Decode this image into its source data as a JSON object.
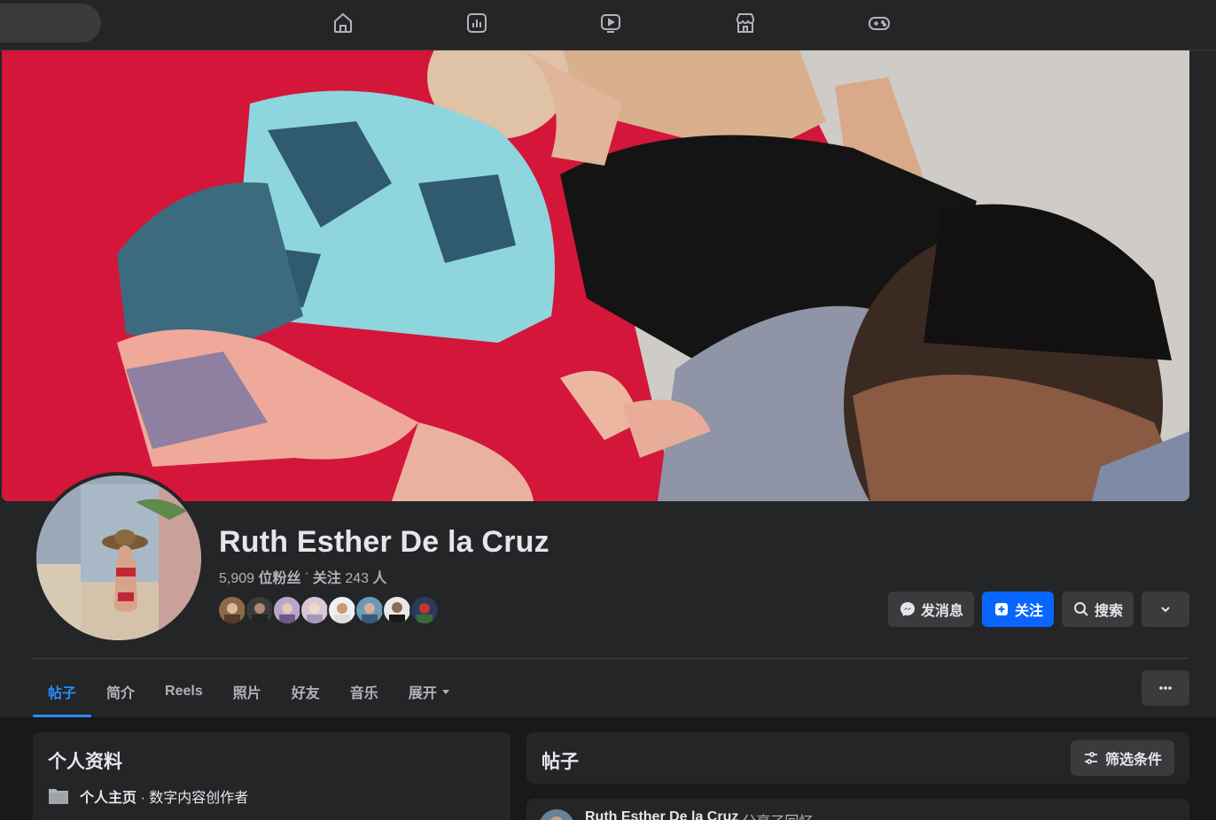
{
  "nav": {
    "icons": [
      "home-icon",
      "dashboard-icon",
      "video-icon",
      "marketplace-icon",
      "gaming-icon"
    ]
  },
  "profile": {
    "name": "Ruth Esther De la Cruz",
    "followers_count": "5,909",
    "followers_label": "位粉丝",
    "separator": "·",
    "following_label": "关注",
    "following_count": "243",
    "following_unit": "人"
  },
  "actions": {
    "message": "发消息",
    "follow": "关注",
    "search": "搜索"
  },
  "tabs": [
    {
      "label": "帖子",
      "active": true
    },
    {
      "label": "简介"
    },
    {
      "label": "Reels"
    },
    {
      "label": "照片"
    },
    {
      "label": "好友"
    },
    {
      "label": "音乐"
    },
    {
      "label": "展开"
    }
  ],
  "intro": {
    "title": "个人资料",
    "page_label": "个人主页",
    "page_category": " · 数字内容创作者"
  },
  "posts": {
    "title": "帖子",
    "filter_label": "筛选条件",
    "first_post": {
      "author": "Ruth Esther De la Cruz",
      "action": "分享了回忆"
    }
  },
  "colors": {
    "background": "#18191a",
    "surface": "#242526",
    "button": "#3a3b3c",
    "accent": "#0866ff",
    "active_tab": "#2d88ff"
  }
}
